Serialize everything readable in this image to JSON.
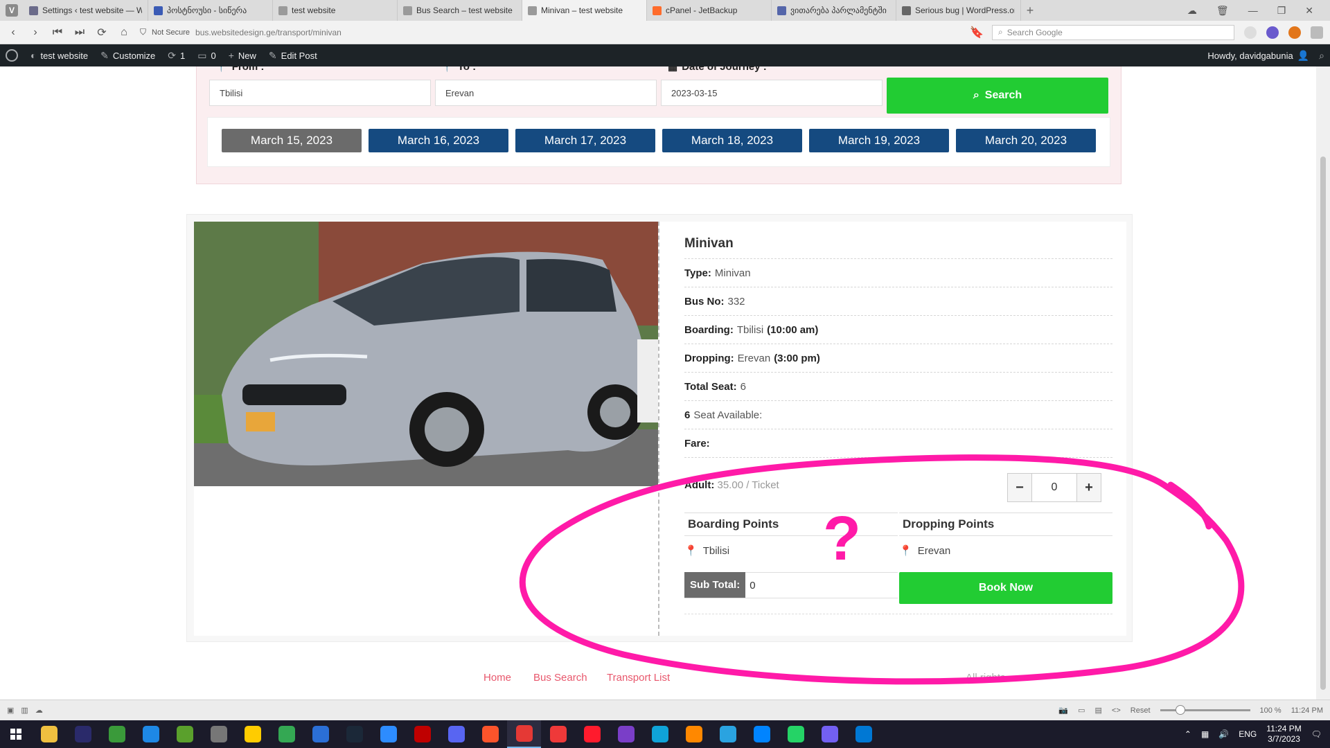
{
  "browser": {
    "tabs": [
      {
        "label": "Settings ‹ test website — W",
        "fav": "#6b6b8a"
      },
      {
        "label": "პოსტნოუსი - სიწერა",
        "fav": "#3b5bb5"
      },
      {
        "label": "test website",
        "fav": "#9a9a9a"
      },
      {
        "label": "Bus Search – test website",
        "fav": "#9a9a9a"
      },
      {
        "label": "Minivan – test website",
        "fav": "#9a9a9a",
        "active": true
      },
      {
        "label": "cPanel - JetBackup",
        "fav": "#ff6c2c"
      },
      {
        "label": "ვითარება პარლამენტში",
        "fav": "#5566aa"
      },
      {
        "label": "Serious bug | WordPress.or",
        "fav": "#666666"
      }
    ],
    "security": "Not Secure",
    "url_host": "bus.websitedesign.ge",
    "url_path": "/transport/minivan",
    "search_placeholder": "Search Google"
  },
  "wpbar": {
    "site": "test website",
    "customize": "Customize",
    "updates": "1",
    "comments": "0",
    "new": "New",
    "edit": "Edit Post",
    "howdy": "Howdy, davidgabunia"
  },
  "search": {
    "from_label": "From :",
    "to_label": "To :",
    "date_label": "Date of Journey :",
    "from_value": "Tbilisi",
    "to_value": "Erevan",
    "date_value": "2023-03-15",
    "button": "Search",
    "dates": [
      "March 15, 2023",
      "March 16, 2023",
      "March 17, 2023",
      "March 18, 2023",
      "March 19, 2023",
      "March 20, 2023"
    ]
  },
  "bus": {
    "name": "Minivan",
    "type_label": "Type:",
    "type": "Minivan",
    "busno_label": "Bus No:",
    "busno": "332",
    "boarding_label": "Boarding:",
    "boarding": "Tbilisi",
    "boarding_time": "(10:00 am)",
    "dropping_label": "Dropping:",
    "dropping": "Erevan",
    "dropping_time": "(3:00 pm)",
    "total_label": "Total Seat:",
    "total": "6",
    "avail_count": "6",
    "avail_text": "Seat Available:",
    "fare_label": "Fare:",
    "adult_label": "Adult:",
    "adult_price": "35.00 / Ticket",
    "qty": "0",
    "boarding_points_title": "Boarding Points",
    "dropping_points_title": "Dropping Points",
    "boarding_point": "Tbilisi",
    "dropping_point": "Erevan",
    "subtotal_label": "Sub Total:",
    "subtotal": "0",
    "book": "Book Now"
  },
  "footer": {
    "links": [
      "Home",
      "Bus Search",
      "Transport List"
    ],
    "rights": "All rights"
  },
  "status": {
    "reset": "Reset",
    "zoom": "100 %",
    "time": "11:24 PM"
  },
  "taskbar": {
    "lang": "ENG",
    "time": "11:24 PM",
    "date": "3/7/2023",
    "apps": [
      "#f0c040",
      "#2a2a6a",
      "#3a9a3a",
      "#1e88e5",
      "#5aa02c",
      "#777",
      "#ffcc00",
      "#34a853",
      "#2b6fd6",
      "#1b2838",
      "#2d8cff",
      "#bf0000",
      "#5865f2",
      "#fb542b",
      "#e53935",
      "#ef3939",
      "#ff1b2d",
      "#7a3ec8",
      "#0fa3d8",
      "#ff8800",
      "#2aa3e0",
      "#0084ff",
      "#25d366",
      "#7360f2",
      "#0078d4"
    ]
  },
  "annotation": {
    "mark": "?",
    "color": "#ff1aa8"
  }
}
